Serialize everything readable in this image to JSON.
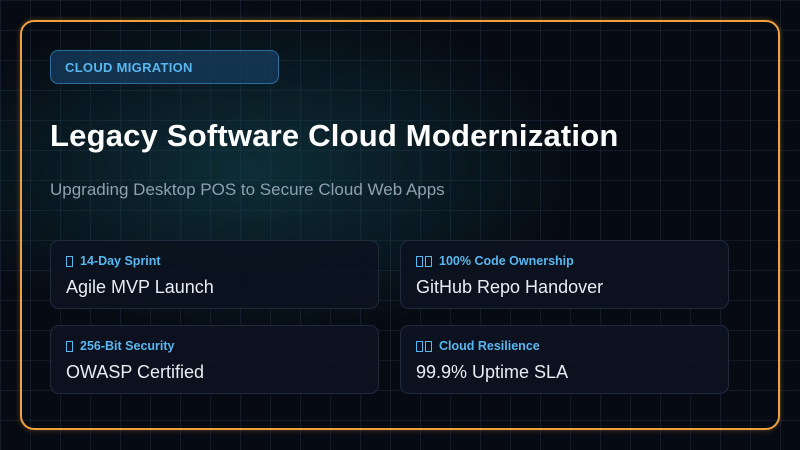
{
  "badge": {
    "label": "CLOUD MIGRATION"
  },
  "title": "Legacy Software Cloud Modernization",
  "subtitle": "Upgrading Desktop POS to Secure Cloud Web Apps",
  "cards": [
    {
      "icon": "calendar-icon",
      "label": "14-Day Sprint",
      "value": "Agile MVP Launch"
    },
    {
      "icon": "code-icon",
      "label": "100% Code Ownership",
      "value": "GitHub Repo Handover"
    },
    {
      "icon": "lock-icon",
      "label": "256-Bit Security",
      "value": "OWASP Certified"
    },
    {
      "icon": "cloud-icon",
      "label": "Cloud Resilience",
      "value": "99.9% Uptime SLA"
    }
  ],
  "colors": {
    "accent": "#58b7f0",
    "frame": "#f0a03c",
    "background": "#060a12"
  }
}
